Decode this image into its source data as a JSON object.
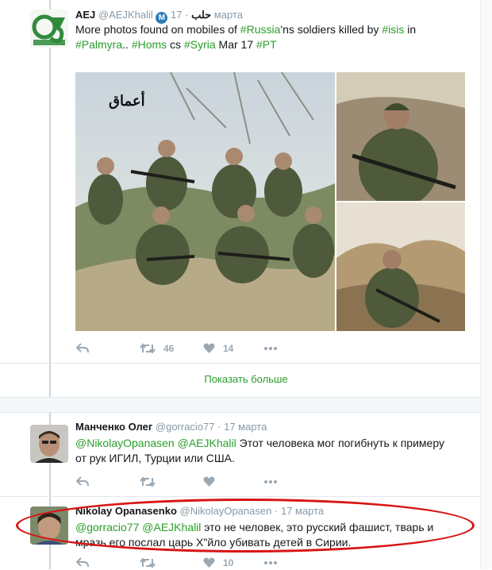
{
  "tweets": [
    {
      "name": "AEJ",
      "handle": "@AEJKhalil",
      "badge_letter": "M",
      "arabic": "حلب",
      "date": "17 марта",
      "text_parts": [
        {
          "t": "More photos found on mobiles of "
        },
        {
          "t": "#Russia",
          "link": true
        },
        {
          "t": "'ns soldiers killed by "
        },
        {
          "t": "#isis",
          "link": true
        },
        {
          "t": " in "
        },
        {
          "t": "#Palmyra",
          "link": true
        },
        {
          "t": ".. "
        },
        {
          "t": "#Homs",
          "link": true
        },
        {
          "t": " cs "
        },
        {
          "t": "#Syria",
          "link": true
        },
        {
          "t": " Mar 17 "
        },
        {
          "t": "#PT",
          "link": true
        }
      ],
      "photo_watermark": "أعماق",
      "retweets": "46",
      "likes": "14"
    },
    {
      "name": "Манченко Олег",
      "handle": "@gorracio77",
      "date": "17 марта",
      "text_parts": [
        {
          "t": "@NikolayOpanasen",
          "link": true
        },
        {
          "t": " "
        },
        {
          "t": "@AEJKhalil",
          "link": true
        },
        {
          "t": " Этот человека мог погибнуть к примеру от рук ИГИЛ, Турции или США."
        }
      ]
    },
    {
      "name": "Nikolay Opanasenko",
      "handle": "@NikolayOpanasen",
      "date": "17 марта",
      "text_parts": [
        {
          "t": "@gorracio77",
          "link": true
        },
        {
          "t": " "
        },
        {
          "t": "@AEJKhalil",
          "link": true
        },
        {
          "t": " это не человек, это русский фашист, тварь и мразь его послал царь Х\"йло убивать детей в Сирии."
        }
      ],
      "likes": "10"
    }
  ],
  "show_more": "Показать больше",
  "dot": "·",
  "colors": {
    "link": "#2a9d2a",
    "meta": "#8899a6",
    "highlight": "#d81414"
  }
}
